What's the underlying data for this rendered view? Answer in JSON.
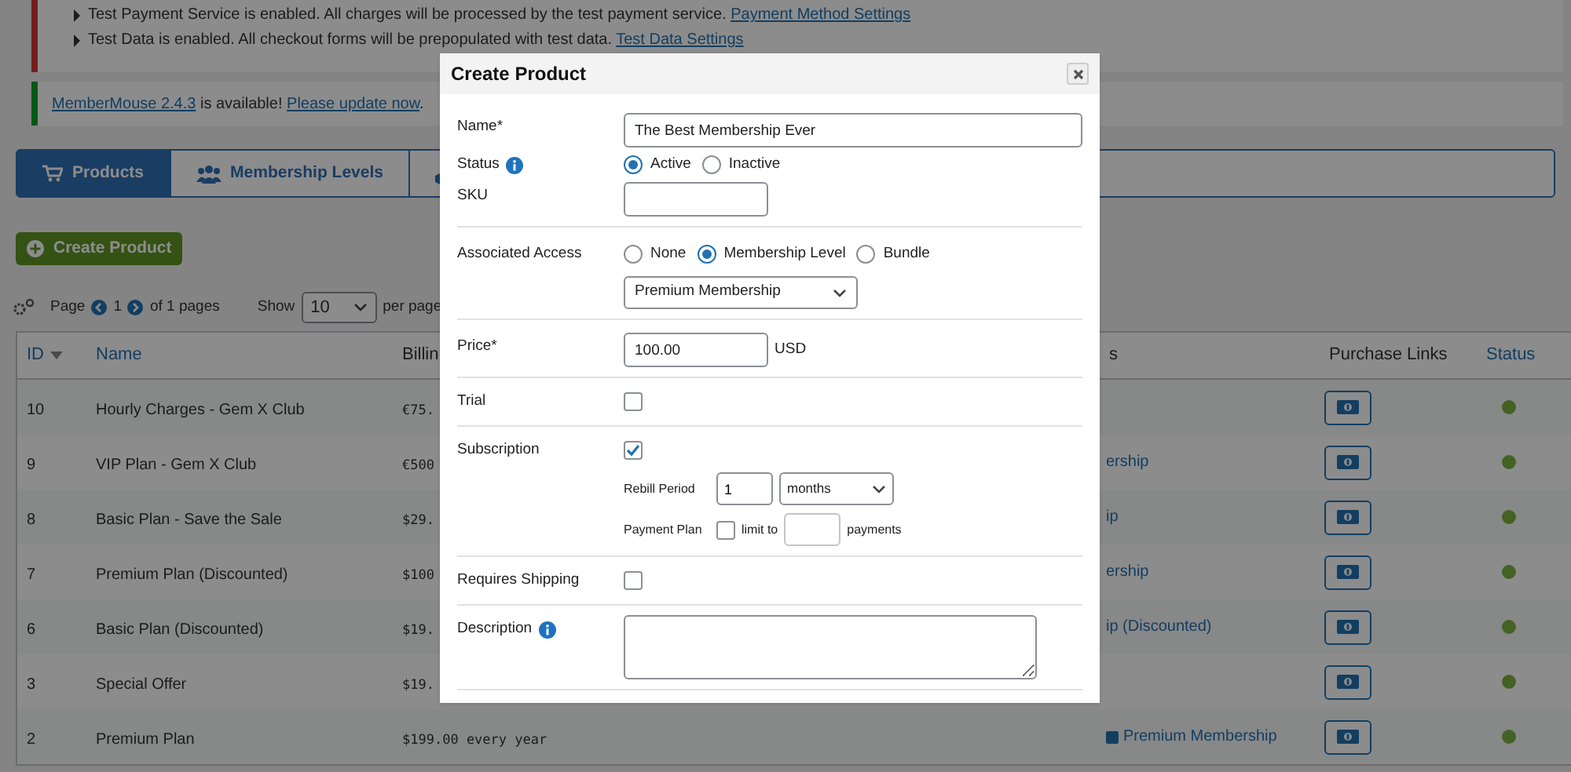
{
  "notices": [
    {
      "kind": "error",
      "lines": [
        {
          "text": "Test Payment Service is enabled. All charges will be processed by the test payment service.",
          "link": "Payment Method Settings"
        },
        {
          "text": "Test Data is enabled. All checkout forms will be prepopulated with test data.",
          "link": "Test Data Settings"
        }
      ]
    },
    {
      "kind": "success",
      "parts": [
        {
          "text": "MemberMouse 2.4.3",
          "link": true
        },
        {
          "text": " is available! ",
          "link": false
        },
        {
          "text": "Please update now",
          "link": true
        },
        {
          "text": ".",
          "link": false
        }
      ]
    }
  ],
  "tabs": [
    {
      "label": "Products",
      "selected": true
    },
    {
      "label": "Membership Levels",
      "selected": false
    },
    {
      "selected": false
    }
  ],
  "create_button": "Create Product",
  "pagination": {
    "page_label": "Page",
    "page": "1",
    "of_pages": "of 1 pages",
    "show_label": "Show",
    "per_page": "10",
    "per_page_label": "per page"
  },
  "table": {
    "columns": [
      {
        "label": "ID",
        "kind": "sorted"
      },
      {
        "label": "Name",
        "kind": "sortable"
      },
      {
        "label": "Billin",
        "kind": "plain"
      },
      {
        "label": "s",
        "kind": "plain"
      },
      {
        "label": "Purchase Links",
        "kind": "plain"
      },
      {
        "label": "Status",
        "kind": "sortable"
      }
    ],
    "rows": [
      {
        "id": "10",
        "name": "Hourly Charges - Gem X Club",
        "billing": "€75.",
        "active": true
      },
      {
        "id": "9",
        "name": "VIP Plan - Gem X Club",
        "billing": "€500",
        "access": "ership",
        "active": true
      },
      {
        "id": "8",
        "name": "Basic Plan - Save the Sale",
        "billing": "$29.",
        "access": "ip",
        "active": true
      },
      {
        "id": "7",
        "name": "Premium Plan (Discounted)",
        "billing": "$100",
        "access": "ership",
        "active": true
      },
      {
        "id": "6",
        "name": "Basic Plan (Discounted)",
        "billing": "$19.",
        "access": "ip (Discounted)",
        "active": true
      },
      {
        "id": "3",
        "name": "Special Offer",
        "billing": "$19.",
        "active": true
      },
      {
        "id": "2",
        "name": "Premium Plan",
        "billing": "$199.00 every year",
        "access": "Premium Membership",
        "access_icon": true,
        "active": true
      }
    ]
  },
  "modal": {
    "title": "Create Product",
    "sections": [
      [
        {
          "kind": "text",
          "label": "Name*",
          "info": false,
          "value": "The Best Membership Ever",
          "wide": true
        },
        {
          "kind": "radio",
          "label": "Status",
          "info": true,
          "options": [
            {
              "label": "Active",
              "selected": true
            },
            {
              "label": "Inactive",
              "selected": false
            }
          ]
        },
        {
          "kind": "text",
          "label": "SKU",
          "info": false,
          "wide": false
        }
      ],
      [
        {
          "kind": "radio",
          "label": "Associated Access",
          "info": false,
          "options": [
            {
              "label": "None",
              "selected": false
            },
            {
              "label": "Membership Level",
              "selected": true
            },
            {
              "label": "Bundle",
              "selected": false
            }
          ]
        },
        {
          "kind": "select",
          "value": "Premium Membership"
        }
      ],
      [
        {
          "kind": "text",
          "label": "Price*",
          "info": false,
          "value": "100.00",
          "suffix": "USD",
          "wide": false
        }
      ],
      [
        {
          "kind": "checkbox",
          "label": "Trial",
          "info": false,
          "checked": false
        }
      ],
      [
        {
          "kind": "checkbox",
          "label": "Subscription",
          "info": false,
          "checked": true
        },
        {
          "kind": "rebill",
          "label": "Rebill Period",
          "value": "1",
          "unit": "months"
        },
        {
          "kind": "payment_plan",
          "label": "Payment Plan",
          "checked": false,
          "text": "limit to",
          "suffix": "payments"
        }
      ],
      [
        {
          "kind": "checkbox",
          "label": "Requires Shipping",
          "info": false,
          "checked": false
        }
      ],
      [
        {
          "kind": "textarea",
          "label": "Description",
          "info": true
        }
      ]
    ]
  }
}
